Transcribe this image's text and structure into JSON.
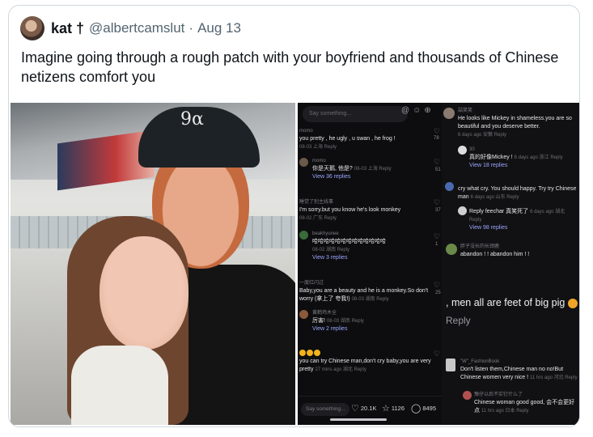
{
  "tweet": {
    "display_name": "kat †",
    "handle": "@albertcamslut",
    "separator": "·",
    "date": "Aug 13",
    "text": "Imagine going through a rough patch with your boyfriend and thousands of Chinese netizens comfort you"
  },
  "photo": {
    "cap_logo": "9α"
  },
  "screenshot": {
    "search_placeholder": "Say something...",
    "left": [
      {
        "user": "momo",
        "text": "you pretty , he ugly , u swan , he frog !",
        "meta": "08-03 上海 Reply",
        "likes": "78"
      },
      {
        "user": "momo",
        "text": "你是天鹅, 他是?",
        "meta": "08-03 上海 Reply",
        "likes": "51",
        "view": "View 36 replies"
      },
      {
        "user": "睡觉了别主线事",
        "text": "I'm sorry.but you know  he's look monkey",
        "meta": "08-02 广东 Reply",
        "likes": "37"
      },
      {
        "user": "beakhyunee",
        "text": "哈哈哈哈哈哈哈哈哈哈哈哈哈",
        "meta": "08-02 湖南 Reply",
        "likes": "1",
        "view": "View 3 replies"
      },
      {
        "user": "一度红闪过",
        "text": "Baby,you are a beauty and he is a monkey.So don't worry (拿上了 夸我!)",
        "meta": "08-03 湖南 Reply",
        "likes": "25"
      },
      {
        "user": "黄鹤鸡木全",
        "text": "厉害!",
        "meta": "08-03 湖南 Reply",
        "likes": "",
        "view": "View 2 replies"
      },
      {
        "user": "",
        "text": "you can try Chinese man,don't cry baby,you are  very pretty",
        "meta": "27 mins ago 湖北 Reply",
        "likes": ""
      }
    ],
    "right": [
      {
        "user": "喆笑笑",
        "text": "He looks like Mickey in shameless.you are so beautiful and you deserve better.",
        "meta": "6 days ago 安徽 Reply"
      },
      {
        "user": "30",
        "text": "真的好像Mickey !",
        "meta": "6 days ago 浙江 Reply",
        "view": "View 18 replies"
      },
      {
        "user": "",
        "text": "cry what cry. You should happy. Try try Chinese man",
        "meta": "6 days ago 山东 Reply"
      },
      {
        "user": "",
        "text": "Reply feechar 真笑死了",
        "meta": "6 days ago 湖北 Reply",
        "view": "View 98 replies"
      },
      {
        "user": "胖子没长的长颈鹿",
        "text": "abandon ! ! abandon him ! !",
        "meta": ""
      },
      {
        "user": "\"W\"_FashionBook",
        "text": "Don't listen them,Chinese man no no!But Chinese women very nice !",
        "meta": "11 hrs ago 河北 Reply"
      },
      {
        "user": "豫仔以后不实钉什么了",
        "text": "Chinese woman good good, 会不会更好点",
        "meta": "11 hrs ago 日本 Reply"
      }
    ],
    "zoom_line": ", men all are feet of big pig",
    "zoom_reply": "Reply",
    "bottom": {
      "input": "Say something...",
      "likes": "20.1K",
      "stars": "1126",
      "comments": "8495"
    }
  }
}
